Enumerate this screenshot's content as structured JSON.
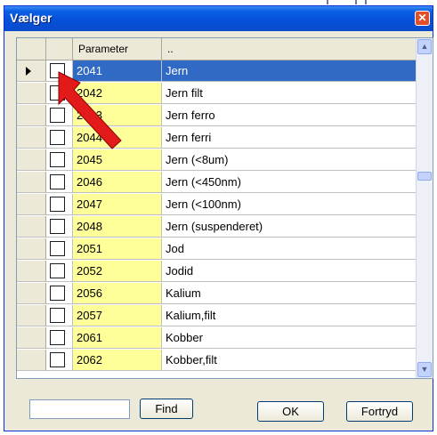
{
  "window": {
    "title": "Vælger",
    "close_label": "✕"
  },
  "grid": {
    "columns": [
      "",
      "",
      "Parameter",
      ".."
    ],
    "rows": [
      {
        "code": "2041",
        "name": "Jern",
        "selected": true
      },
      {
        "code": "2042",
        "name": "Jern filt"
      },
      {
        "code": "2043",
        "name": "Jern ferro"
      },
      {
        "code": "2044",
        "name": "Jern ferri"
      },
      {
        "code": "2045",
        "name": "Jern (<8um)"
      },
      {
        "code": "2046",
        "name": "Jern (<450nm)"
      },
      {
        "code": "2047",
        "name": "Jern (<100nm)"
      },
      {
        "code": "2048",
        "name": "Jern (suspenderet)"
      },
      {
        "code": "2051",
        "name": "Jod"
      },
      {
        "code": "2052",
        "name": "Jodid"
      },
      {
        "code": "2056",
        "name": "Kalium"
      },
      {
        "code": "2057",
        "name": "Kalium,filt"
      },
      {
        "code": "2061",
        "name": "Kobber"
      },
      {
        "code": "2062",
        "name": "Kobber,filt"
      }
    ]
  },
  "footer": {
    "find_value": "",
    "find_label": "Find",
    "ok_label": "OK",
    "cancel_label": "Fortryd"
  },
  "colors": {
    "selection": "#316ac5",
    "param_column": "#ffff99",
    "annotation_arrow": "#e00000"
  }
}
